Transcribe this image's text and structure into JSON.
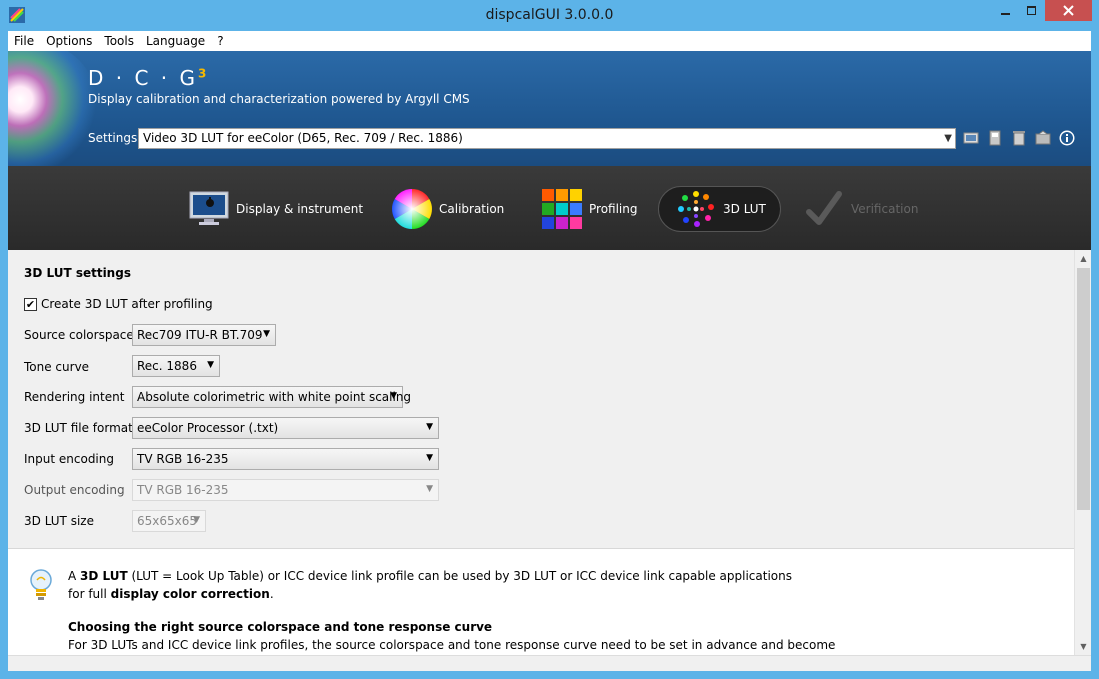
{
  "window": {
    "title": "dispcalGUI 3.0.0.0"
  },
  "menu": [
    "File",
    "Options",
    "Tools",
    "Language",
    "?"
  ],
  "header": {
    "brand": "D · C · G",
    "brand_sup": "3",
    "tagline": "Display calibration and characterization powered by Argyll CMS",
    "settings_label": "Settings",
    "settings_value": "Video 3D LUT for eeColor (D65, Rec. 709 / Rec. 1886)"
  },
  "tabs": [
    {
      "label": "Display & instrument",
      "state": "normal"
    },
    {
      "label": "Calibration",
      "state": "normal"
    },
    {
      "label": "Profiling",
      "state": "normal"
    },
    {
      "label": "3D LUT",
      "state": "active"
    },
    {
      "label": "Verification",
      "state": "disabled"
    }
  ],
  "lut": {
    "section_title": "3D LUT settings",
    "create_checkbox": "Create 3D LUT after profiling",
    "create_checked": true,
    "rows": [
      {
        "label": "Source colorspace",
        "value": "Rec709 ITU-R BT.709",
        "disabled": false
      },
      {
        "label": "Tone curve",
        "value": "Rec. 1886",
        "disabled": false
      },
      {
        "label": "Rendering intent",
        "value": "Absolute colorimetric with white point scaling",
        "disabled": false
      },
      {
        "label": "3D LUT file format",
        "value": "eeColor Processor (.txt)",
        "disabled": false
      },
      {
        "label": "Input encoding",
        "value": "TV RGB 16-235",
        "disabled": false
      },
      {
        "label": "Output encoding",
        "value": "TV RGB 16-235",
        "disabled": true
      },
      {
        "label": "3D LUT size",
        "value": "65x65x65",
        "disabled": true
      }
    ]
  },
  "info": {
    "p1_a": "A ",
    "p1_b": "3D LUT",
    "p1_c": " (LUT = Look Up Table) or ICC device link profile can be used by 3D LUT or ICC device link capable applications",
    "p2_a": "for full ",
    "p2_b": "display color correction",
    "p2_c": ".",
    "heading": "Choosing the right source colorspace and tone response curve",
    "p3": "For 3D LUTs and ICC device link profiles, the source colorspace and tone response curve need to be set in advance and become"
  },
  "colors": {
    "accent": "#1f5790",
    "titlebar": "#5cb3e8",
    "close": "#c75050",
    "tabbar": "#2e2e2e"
  }
}
